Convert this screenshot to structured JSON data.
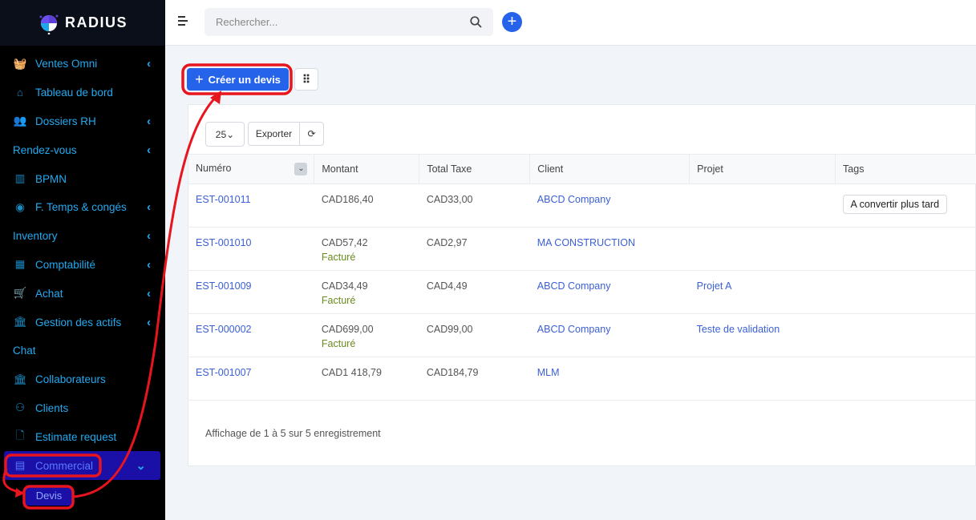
{
  "app": {
    "brand": "RADIUS"
  },
  "sidebar": {
    "items": [
      {
        "label": "Ventes Omni",
        "icon": "basket-icon",
        "chev": true
      },
      {
        "label": "Tableau de bord",
        "icon": "home-icon",
        "chev": false
      },
      {
        "label": "Dossiers RH",
        "icon": "users-icon",
        "chev": true
      },
      {
        "label": "Rendez-vous",
        "icon": "",
        "chev": true
      },
      {
        "label": "BPMN",
        "icon": "map-icon",
        "chev": false
      },
      {
        "label": "F. Temps & congés",
        "icon": "user-circle-icon",
        "chev": true
      },
      {
        "label": "Inventory",
        "icon": "",
        "chev": true
      },
      {
        "label": "Comptabilité",
        "icon": "calculator-icon",
        "chev": true
      },
      {
        "label": "Achat",
        "icon": "cart-icon",
        "chev": true
      },
      {
        "label": "Gestion des actifs",
        "icon": "bank-icon",
        "chev": true
      },
      {
        "label": "Chat",
        "icon": "",
        "chev": false
      },
      {
        "label": "Collaborateurs",
        "icon": "bank-icon",
        "chev": false
      },
      {
        "label": "Clients",
        "icon": "user-icon",
        "chev": false
      },
      {
        "label": "Estimate request",
        "icon": "file-icon",
        "chev": false
      },
      {
        "label": "Commercial",
        "icon": "receipt-icon",
        "chev": true
      }
    ],
    "sub_item": "Devis"
  },
  "topbar": {
    "search_placeholder": "Rechercher..."
  },
  "toolbar": {
    "create_label": "Créer un devis",
    "page_size": "25",
    "export_label": "Exporter"
  },
  "table": {
    "columns": [
      "Numéro",
      "Montant",
      "Total Taxe",
      "Client",
      "Projet",
      "Tags"
    ],
    "rows": [
      {
        "num": "EST-001011",
        "amount": "CAD186,40",
        "status": "",
        "tax": "CAD33,00",
        "client": "ABCD Company",
        "project": "",
        "tag": "A convertir plus tard"
      },
      {
        "num": "EST-001010",
        "amount": "CAD57,42",
        "status": "Facturé",
        "tax": "CAD2,97",
        "client": "MA CONSTRUCTION",
        "project": "",
        "tag": ""
      },
      {
        "num": "EST-001009",
        "amount": "CAD34,49",
        "status": "Facturé",
        "tax": "CAD4,49",
        "client": "ABCD Company",
        "project": "Projet A",
        "tag": ""
      },
      {
        "num": "EST-000002",
        "amount": "CAD699,00",
        "status": "Facturé",
        "tax": "CAD99,00",
        "client": "ABCD Company",
        "project": "Teste de validation",
        "tag": ""
      },
      {
        "num": "EST-001007",
        "amount": "CAD1 418,79",
        "status": "",
        "tax": "CAD184,79",
        "client": "MLM",
        "project": "",
        "tag": ""
      }
    ]
  },
  "footer": {
    "info": "Affichage de 1 à 5 sur 5 enregistrement"
  },
  "colors": {
    "accent": "#2563eb",
    "sidebar_active": "#1a0fa6",
    "annotation": "#e8141e"
  }
}
